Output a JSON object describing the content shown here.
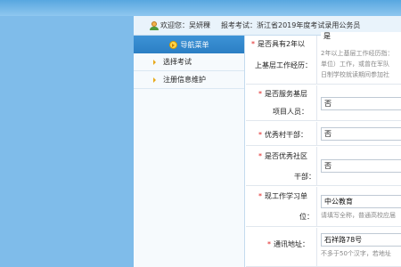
{
  "header": {
    "welcome": "欢迎您：吴妍稞",
    "exam": "报考考试：浙江省2019年度考试录用公务员"
  },
  "nav": {
    "title": "导航菜单",
    "items": [
      {
        "label": "选择考试"
      },
      {
        "label": "注册信息维护"
      }
    ]
  },
  "form": {
    "grassroots_exp": {
      "label_line1": "是否具有2年以",
      "label_line2": "上基层工作经历：",
      "value": "是",
      "hint_line1": "2年以上基层工作经历指：",
      "hint_line2": "单位）工作，或曾在军队",
      "hint_line3": "日制学校就读期间参加社"
    },
    "grassroots_service": {
      "label_line1": "是否服务基层",
      "label_line2": "项目人员：",
      "value": "否"
    },
    "village_cadre": {
      "label": "优秀村干部：",
      "value": "否"
    },
    "community_cadre": {
      "label_line1": "是否优秀社区",
      "label_line2": "干部：",
      "value": "否"
    },
    "work_unit": {
      "label_line1": "现工作学习单",
      "label_line2": "位：",
      "value": "中公教育",
      "hint": "请填写全称，普通高校应届"
    },
    "address": {
      "label": "通讯地址：",
      "value": "石祥路78号",
      "hint": "不多于50个汉字，若地址"
    }
  }
}
